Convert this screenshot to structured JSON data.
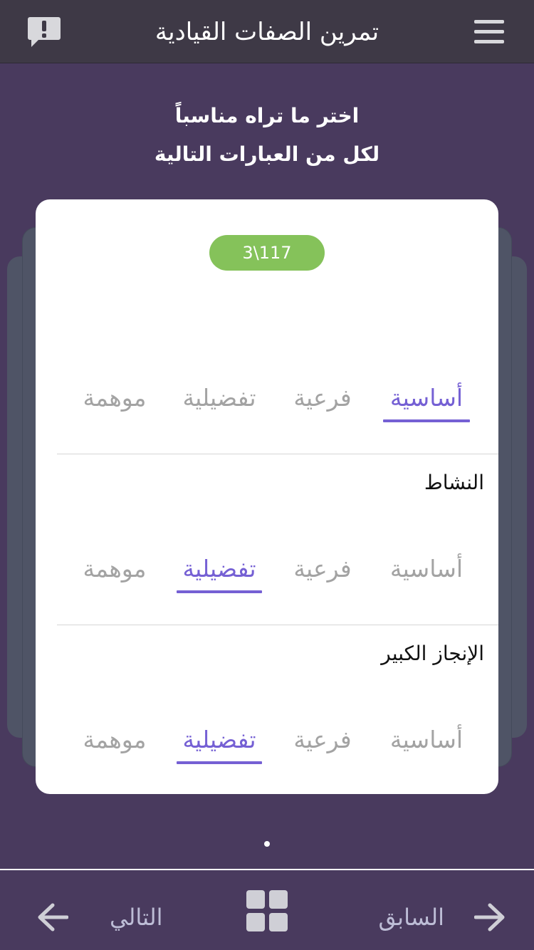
{
  "header": {
    "title": "تمرين الصفات القيادية"
  },
  "instructions": {
    "line1": "اختر ما تراه مناسباً",
    "line2": "لكل من العبارات التالية"
  },
  "progress": {
    "counter": "3\\117"
  },
  "questions": [
    {
      "statement": "",
      "options": [
        "أساسية",
        "فرعية",
        "تفضيلية",
        "موهمة"
      ],
      "selected": "أساسية"
    },
    {
      "statement": "النشاط",
      "options": [
        "أساسية",
        "فرعية",
        "تفضيلية",
        "موهمة"
      ],
      "selected": "تفضيلية"
    },
    {
      "statement": "الإنجاز الكبير",
      "options": [
        "أساسية",
        "فرعية",
        "تفضيلية",
        "موهمة"
      ],
      "selected": "تفضيلية"
    }
  ],
  "footer": {
    "prev_label": "السابق",
    "next_label": "التالي"
  },
  "colors": {
    "background": "#493a5e",
    "topbar": "#3e3946",
    "accent": "#7560d4",
    "counter_badge": "#85c25a",
    "unselected_option": "#a3a3a3"
  },
  "icons": {
    "menu": "hamburger-menu-icon",
    "report": "report-issue-icon",
    "grid": "grid-icon",
    "prev": "arrow-right-icon",
    "next": "arrow-left-icon"
  }
}
